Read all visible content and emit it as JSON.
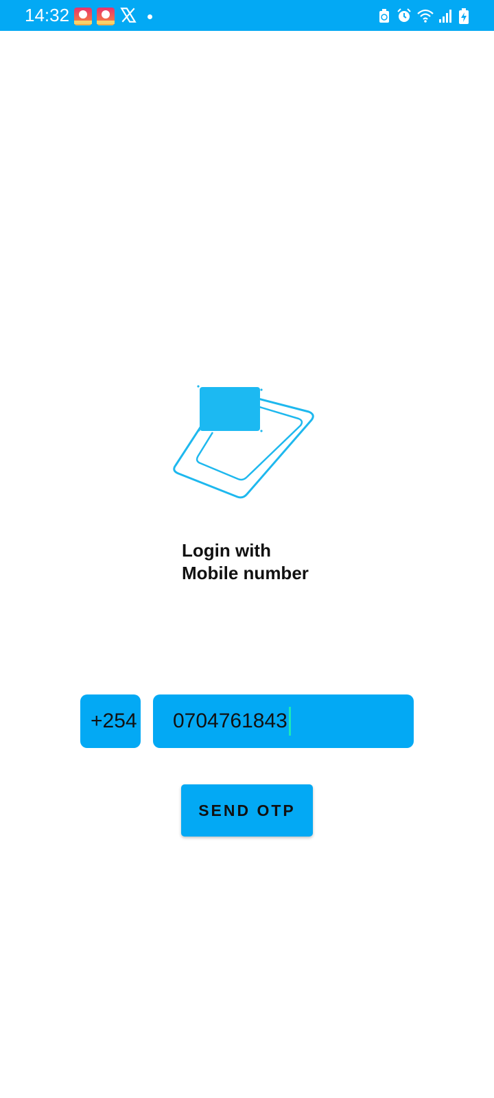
{
  "status_bar": {
    "time": "14:32",
    "background": "#03A9F4",
    "notification_icons": [
      "karaoke-app-icon",
      "karaoke-app-icon",
      "x-icon",
      "dot-icon"
    ],
    "system_icons": [
      "battery-saver-icon",
      "alarm-icon",
      "wifi-icon",
      "signal-icon",
      "battery-charging-icon"
    ]
  },
  "login": {
    "title_line1": "Login with",
    "title_line2": "Mobile number",
    "illustration_icon": "phone-sim-illustration-icon",
    "country_code": "+254",
    "phone_number": "0704761843",
    "send_button_label": "SEND OTP"
  },
  "colors": {
    "accent": "#03A9F4",
    "illustration": "#1EB8EE",
    "caret": "#1DE9B6",
    "text": "#111111"
  }
}
